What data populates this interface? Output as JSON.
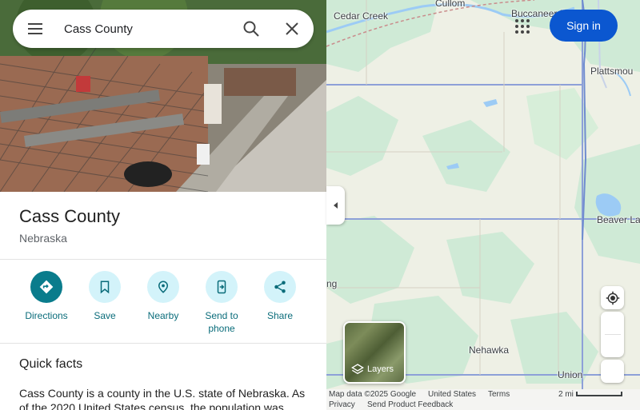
{
  "search": {
    "value": "Cass County"
  },
  "place": {
    "title": "Cass County",
    "subtitle": "Nebraska"
  },
  "actions": [
    {
      "label": "Directions",
      "icon": "directions-icon"
    },
    {
      "label": "Save",
      "icon": "bookmark-icon"
    },
    {
      "label": "Nearby",
      "icon": "nearby-icon"
    },
    {
      "label": "Send to phone",
      "icon": "send-to-phone-icon"
    },
    {
      "label": "Share",
      "icon": "share-icon"
    }
  ],
  "quick_facts": {
    "title": "Quick facts",
    "text": "Cass County is a county in the U.S. state of Nebraska. As of the 2020 United States census, the population was"
  },
  "header": {
    "signin_label": "Sign in"
  },
  "map": {
    "labels": {
      "cedar_creek": "Cedar Creek",
      "cullom": "Cullom",
      "buccaneer_bay": "Buccaneer Bay",
      "plattsmouth": "Plattsmou",
      "beaver_lake": "Beaver Lal",
      "nehawka": "Nehawka",
      "union": "Union",
      "ng": "ng"
    },
    "layers_label": "Layers",
    "footer": {
      "map_data": "Map data ©2025 Google",
      "country": "United States",
      "terms": "Terms",
      "privacy": "Privacy",
      "feedback": "Send Product Feedback",
      "scale": "2 mi"
    }
  },
  "colors": {
    "accent": "#0b57d0",
    "action_primary": "#0a7c8c",
    "action_bg": "#d3f3fa",
    "action_text": "#0a6c7a"
  }
}
